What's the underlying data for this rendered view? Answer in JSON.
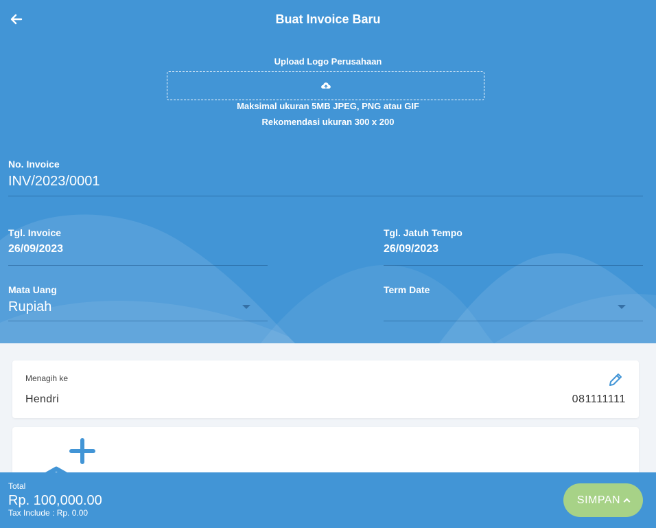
{
  "header": {
    "title": "Buat Invoice Baru",
    "back_icon": "arrow-left-icon"
  },
  "upload": {
    "label": "Upload Logo Perusahaan",
    "icon": "cloud-upload-icon",
    "hint_size": "Maksimal ukuran 5MB JPEG, PNG atau GIF",
    "hint_recommend": "Rekomendasi ukuran 300 x 200"
  },
  "form": {
    "invoice_no": {
      "label": "No. Invoice",
      "value": "INV/2023/0001"
    },
    "invoice_date": {
      "label": "Tgl. Invoice",
      "value": "26/09/2023"
    },
    "due_date": {
      "label": "Tgl. Jatuh Tempo",
      "value": "26/09/2023"
    },
    "currency": {
      "label": "Mata Uang",
      "value": "Rupiah"
    },
    "term_date": {
      "label": "Term Date",
      "value": ""
    }
  },
  "billing": {
    "label": "Menagih ke",
    "name": "Hendri",
    "phone": "081111111",
    "edit_icon": "pencil-icon"
  },
  "items": {
    "add_icon": "add-item-icon"
  },
  "footer": {
    "total_label": "Total",
    "total_value": "Rp. 100,000.00",
    "tax_line": "Tax Include : Rp. 0.00",
    "save_label": "SIMPAN"
  },
  "colors": {
    "primary": "#4295d6",
    "save_button": "#a7d287",
    "background": "#f1f4f8"
  }
}
